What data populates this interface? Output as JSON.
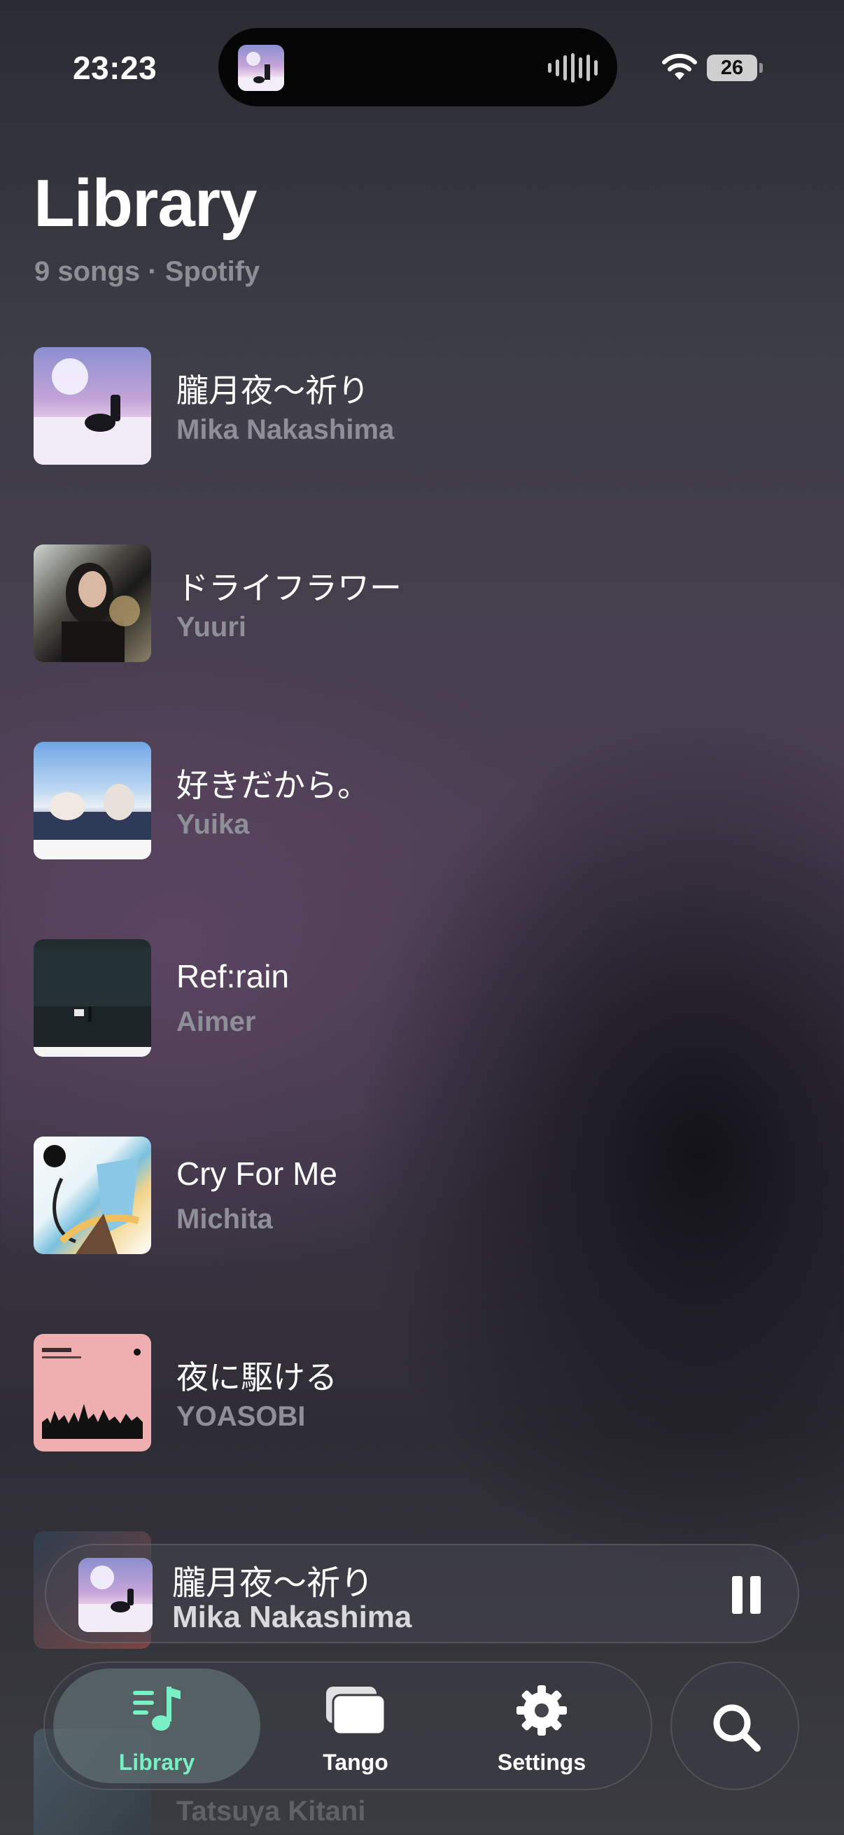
{
  "status_bar": {
    "time": "23:23",
    "battery": "26"
  },
  "header": {
    "title": "Library",
    "subtitle": "9 songs · Spotify"
  },
  "songs": [
    {
      "title": "朧月夜〜祈り",
      "artist": "Mika Nakashima"
    },
    {
      "title": "ドライフラワー",
      "artist": "Yuuri"
    },
    {
      "title": "好きだから。",
      "artist": "Yuika"
    },
    {
      "title": "Ref:rain",
      "artist": "Aimer"
    },
    {
      "title": "Cry For Me",
      "artist": "Michita"
    },
    {
      "title": "夜に駆ける",
      "artist": "YOASOBI"
    },
    {
      "title": "",
      "artist": ""
    },
    {
      "title": "",
      "artist": "Tatsuya Kitani"
    }
  ],
  "now_playing": {
    "title": "朧月夜〜祈り",
    "artist": "Mika Nakashima"
  },
  "tabs": [
    {
      "label": "Library",
      "icon": "music-note-list-icon"
    },
    {
      "label": "Tango",
      "icon": "cards-stack-icon"
    },
    {
      "label": "Settings",
      "icon": "gear-icon"
    }
  ],
  "colors": {
    "accent": "#78f0c3"
  }
}
